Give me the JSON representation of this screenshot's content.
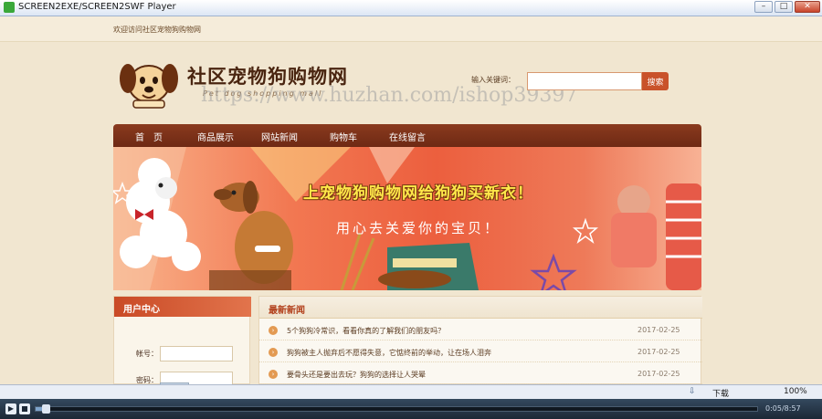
{
  "window": {
    "title": "SCREEN2EXE/SCREEN2SWF Player",
    "min_label": "–",
    "max_label": "□",
    "close_label": "✕"
  },
  "page": {
    "welcome": "欢迎访问社区宠物狗购物网",
    "logo_text": "社区宠物狗购物网",
    "logo_sub": "Pet dog shopping mall",
    "watermark": "https://www.huzhan.com/ishop39397",
    "search": {
      "label": "输入关键词：",
      "value": "",
      "button": "搜索"
    },
    "nav": [
      "首　页",
      "商品展示",
      "网站新闻",
      "购物车",
      "在线留言"
    ],
    "banner": {
      "headline": "上宠物狗购物网给狗狗买新衣！",
      "subline": "用心去关爱你的宝贝！"
    },
    "user_panel": {
      "title": "用户中心",
      "account_label": "帐号：",
      "password_label": "密码："
    },
    "news": {
      "title": "最新新闻",
      "items": [
        {
          "text": "5个狗狗冷常识，看看你真的了解我们的朋友吗？",
          "date": "2017-02-25"
        },
        {
          "text": "狗狗被主人抛弃后不愿得失意，它惦终前的举动，让在场人泪奔",
          "date": "2017-02-25"
        },
        {
          "text": "要骨头还是要出去玩？狗狗的选择让人哭晕",
          "date": "2017-02-25"
        }
      ]
    }
  },
  "status": {
    "download": "下载",
    "zoom": "100%"
  },
  "player": {
    "time": "0:05/8:57",
    "progress": 0.009,
    "play_label": "▶"
  },
  "colors": {
    "nav_bg": "#7a3018",
    "accent": "#c9522a",
    "headline": "#ffe84a"
  }
}
